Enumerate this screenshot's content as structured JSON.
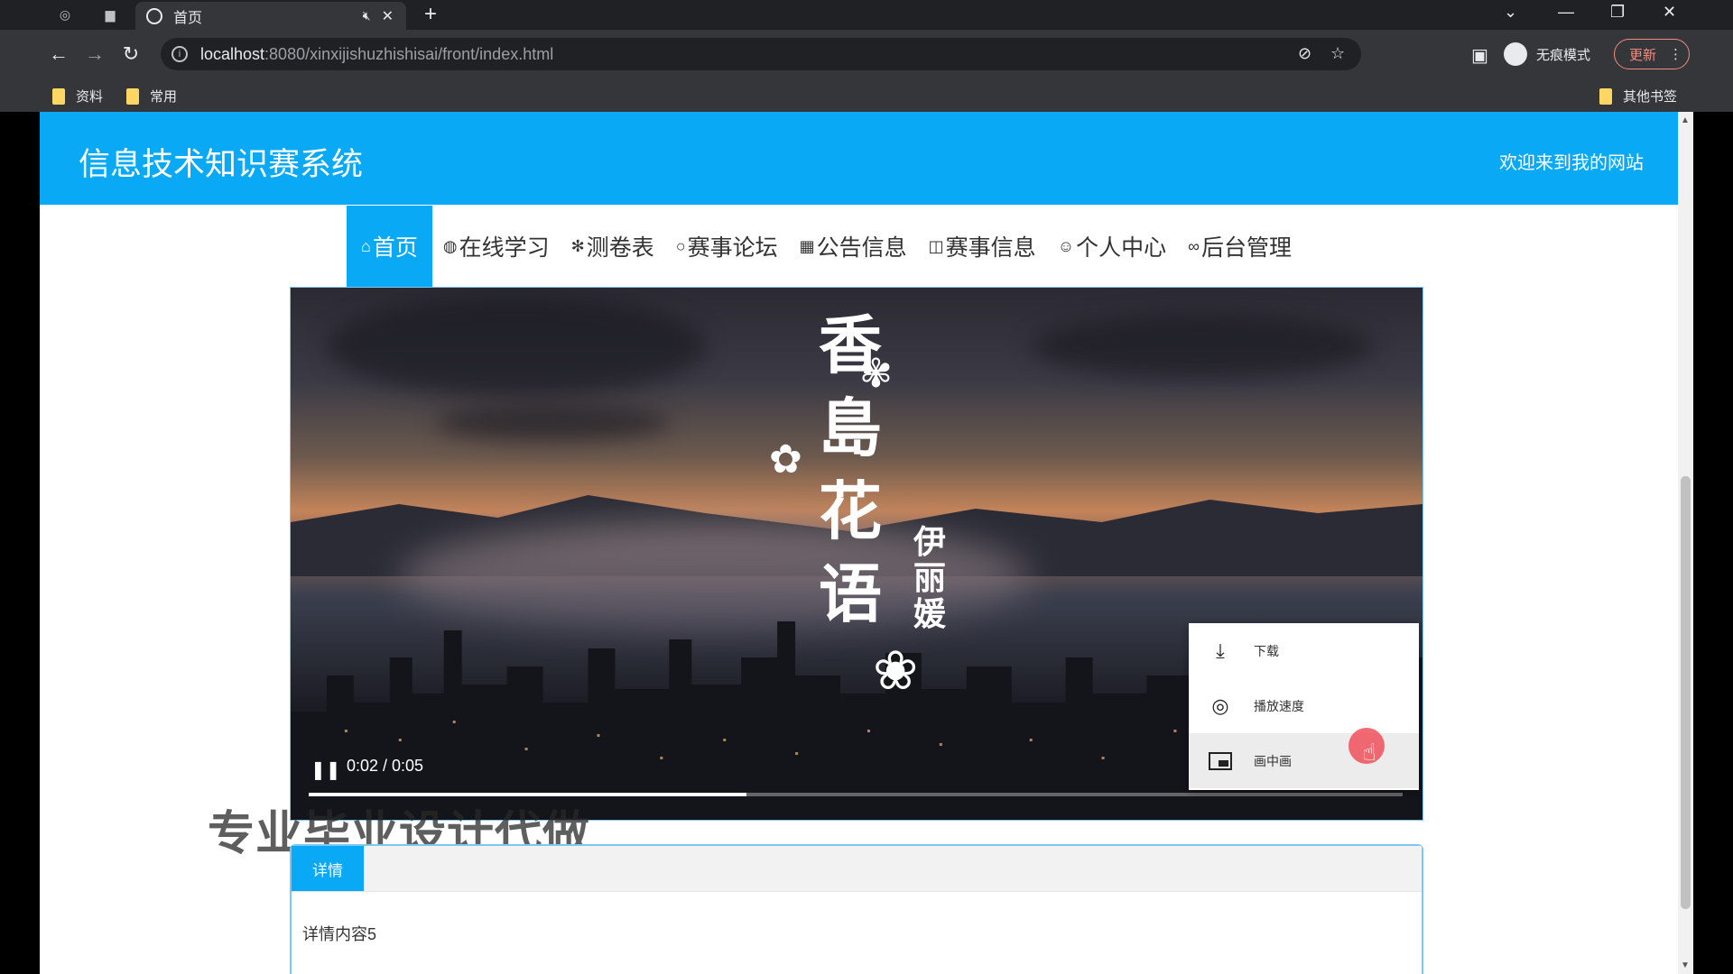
{
  "browser": {
    "tab_title": "首页",
    "url_host": "localhost",
    "url_path": ":8080/xinxijishuzhishisai/front/index.html",
    "incognito_label": "无痕模式",
    "update_label": "更新",
    "bookmarks": [
      "资料",
      "常用"
    ],
    "other_bookmarks": "其他书签"
  },
  "site": {
    "title": "信息技术知识赛系统",
    "welcome": "欢迎来到我的网站",
    "nav": [
      {
        "label": "首页",
        "icon": "home-icon",
        "active": true
      },
      {
        "label": "在线学习",
        "icon": "globe-icon"
      },
      {
        "label": "测卷表",
        "icon": "snowflake-icon"
      },
      {
        "label": "赛事论坛",
        "icon": "circle-icon"
      },
      {
        "label": "公告信息",
        "icon": "grid-icon"
      },
      {
        "label": "赛事信息",
        "icon": "book-icon"
      },
      {
        "label": "个人中心",
        "icon": "user-icon"
      },
      {
        "label": "后台管理",
        "icon": "link-icon"
      }
    ]
  },
  "video": {
    "poem_title": "香島花语",
    "poem_author": "伊丽媛",
    "time": "0:02 / 0:05",
    "progress": 0.4,
    "menu": [
      {
        "label": "下载",
        "icon": "download-icon"
      },
      {
        "label": "播放速度",
        "icon": "playback-speed-icon"
      },
      {
        "label": "画中画",
        "icon": "picture-in-picture-icon",
        "hover": true
      }
    ]
  },
  "watermark": "专业毕业设计代做",
  "detail": {
    "tab": "详情",
    "content": "详情内容5"
  }
}
